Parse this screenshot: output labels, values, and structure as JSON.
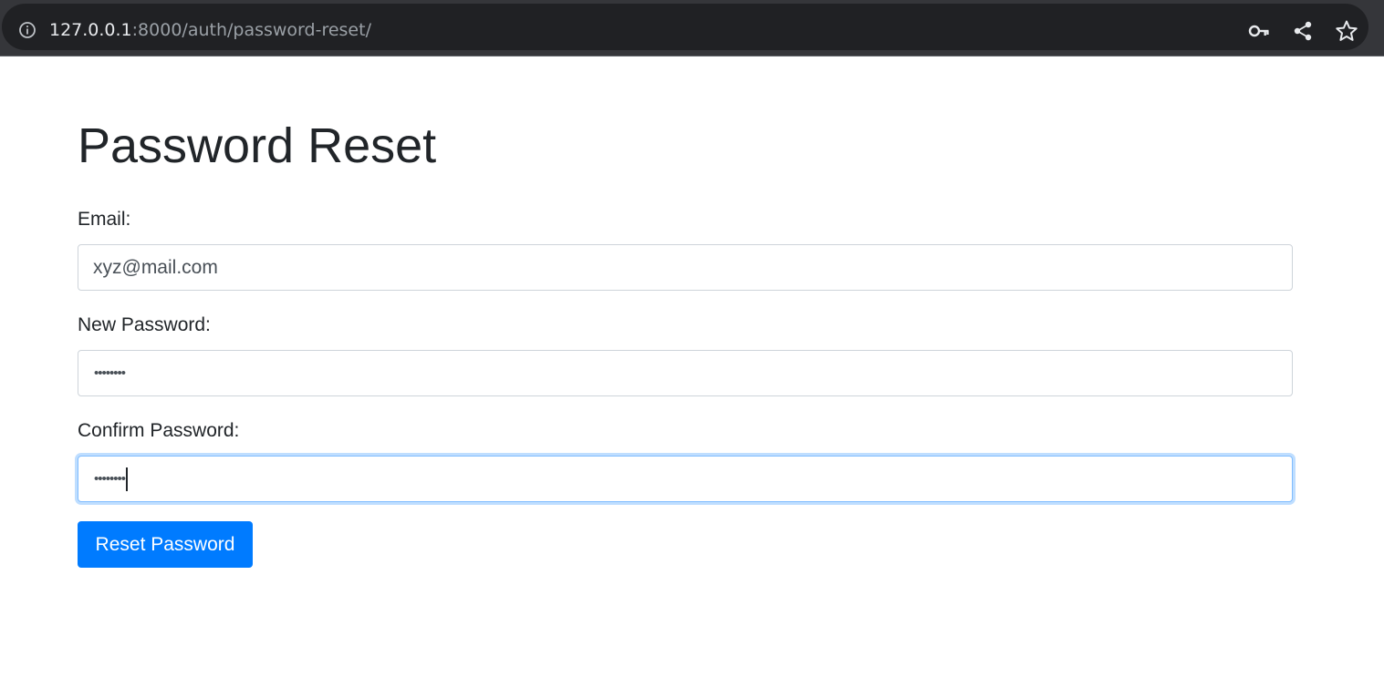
{
  "browser": {
    "url_host": "127.0.0.1",
    "url_rest": ":8000/auth/password-reset/",
    "icons": [
      "info-icon",
      "key-icon",
      "share-icon",
      "star-icon"
    ]
  },
  "page": {
    "title": "Password Reset",
    "email": {
      "label": "Email:",
      "value": "xyz@mail.com"
    },
    "new_password": {
      "label": "New Password:",
      "masked_value": "••••••••"
    },
    "confirm_password": {
      "label": "Confirm Password:",
      "masked_value": "••••••••"
    },
    "submit_label": "Reset Password"
  },
  "colors": {
    "accent": "#007bff",
    "focus_ring": "#80bdff",
    "text": "#212529",
    "browser_bar": "#35363a"
  }
}
